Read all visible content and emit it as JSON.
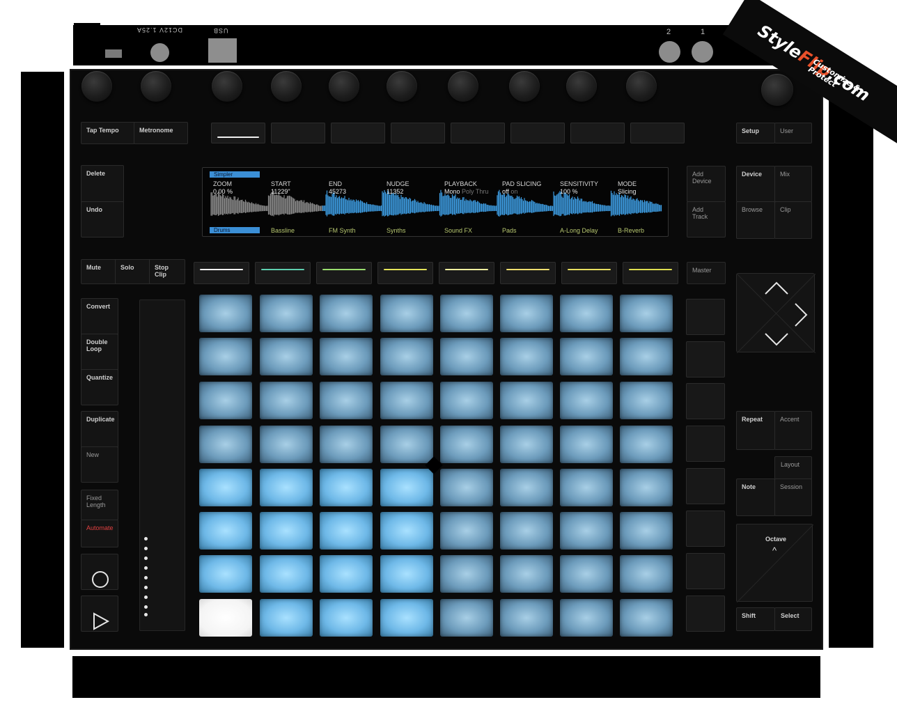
{
  "rear_panel": {
    "power_label": "DC12V 1.25A",
    "usb_label": "USB",
    "pedal_2_label": "2",
    "pedal_1_label": "1"
  },
  "top_left": {
    "tap_tempo": "Tap Tempo",
    "metronome": "Metronome"
  },
  "top_right": {
    "setup": "Setup",
    "user": "User"
  },
  "left_column": {
    "delete": "Delete",
    "undo": "Undo",
    "mute": "Mute",
    "solo": "Solo",
    "stop_clip": "Stop\nClip",
    "convert": "Convert",
    "double_loop": "Double\nLoop",
    "quantize": "Quantize",
    "duplicate": "Duplicate",
    "new": "New",
    "fixed_length": "Fixed\nLength",
    "automate": "Automate"
  },
  "right_column": {
    "add_device": "Add\nDevice",
    "add_track": "Add\nTrack",
    "device": "Device",
    "mix": "Mix",
    "browse": "Browse",
    "clip": "Clip",
    "master": "Master",
    "repeat": "Repeat",
    "accent": "Accent",
    "layout": "Layout",
    "note": "Note",
    "session": "Session",
    "octave": "Octave",
    "octave_up_glyph": "^",
    "shift": "Shift",
    "select": "Select"
  },
  "display": {
    "device_tag": "Simpler",
    "track_tag": "Drums",
    "params": [
      {
        "name": "ZOOM",
        "value": "0.00 %",
        "faint": ""
      },
      {
        "name": "START",
        "value": "11229\"",
        "faint": ""
      },
      {
        "name": "END",
        "value": "45273",
        "faint": ""
      },
      {
        "name": "NUDGE",
        "value": "11352",
        "faint": ""
      },
      {
        "name": "PLAYBACK",
        "value": "Mono",
        "faint": "Poly Thru"
      },
      {
        "name": "PAD SLICING",
        "value": "off",
        "faint": "on"
      },
      {
        "name": "SENSITIVITY",
        "value": "100 %",
        "faint": ""
      },
      {
        "name": "MODE",
        "value": "Slicing",
        "faint": ""
      }
    ],
    "tracks": [
      "",
      "Bassline",
      "FM Synth",
      "Synths",
      "Sound FX",
      "Pads",
      "A-Long Delay",
      "B-Reverb"
    ],
    "colors": {
      "accent": "#3b8fd6",
      "footer_text": "#b8c870"
    }
  },
  "track_select_colors": [
    "#f2f2f2",
    "#5fd0b0",
    "#9be070",
    "#e6e65a",
    "#f0f0a0",
    "#f0e070",
    "#e8e060",
    "#e0e050"
  ],
  "pads": {
    "rows": [
      [
        "dim",
        "dim",
        "dim",
        "dim",
        "dim",
        "dim",
        "dim",
        "dim"
      ],
      [
        "dim",
        "dim",
        "dim",
        "dim",
        "dim",
        "dim",
        "dim",
        "dim"
      ],
      [
        "dim",
        "dim",
        "dim",
        "dim",
        "dim",
        "dim",
        "dim",
        "dim"
      ],
      [
        "dim",
        "dim",
        "dim",
        "dim",
        "dim",
        "dim",
        "dim",
        "dim"
      ],
      [
        "lit",
        "lit",
        "lit",
        "lit",
        "dim",
        "dim",
        "dim",
        "dim"
      ],
      [
        "lit",
        "lit",
        "lit",
        "lit",
        "dim",
        "dim",
        "dim",
        "dim"
      ],
      [
        "lit",
        "lit",
        "lit",
        "lit",
        "dim",
        "dim",
        "dim",
        "dim"
      ],
      [
        "white",
        "lit",
        "lit",
        "lit",
        "dim",
        "dim",
        "dim",
        "dim"
      ]
    ],
    "colors": {
      "lit": "#8fd0f5",
      "dim": "#7aa8c8",
      "white": "#ffffff"
    }
  },
  "icons": {
    "record": "record-icon",
    "play": "play-icon",
    "nav_up": "chevron-up-icon",
    "nav_right": "chevron-right-icon",
    "nav_down": "chevron-down-icon"
  },
  "watermark": {
    "brand_part1": "Style",
    "brand_part2": "Flip",
    "brand_part3": ".com",
    "tagline": "Customize & Protect",
    "brand_color": "#e8502a"
  }
}
